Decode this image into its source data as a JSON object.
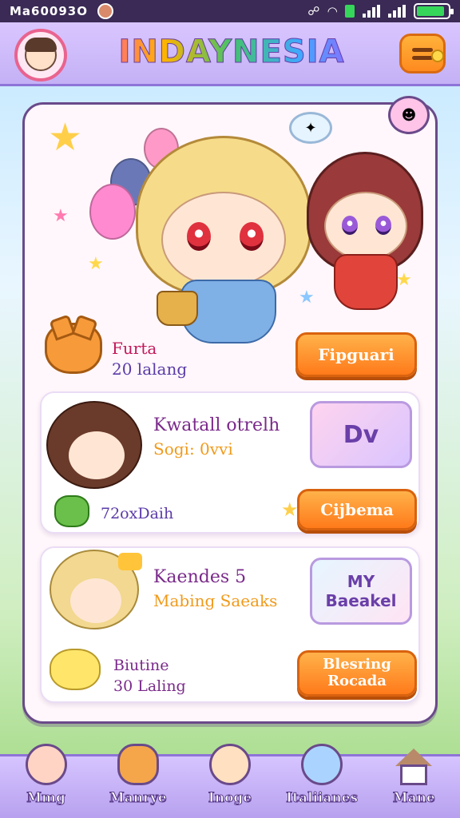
{
  "status_bar": {
    "time": "Ma60093O",
    "battery_percent": 90
  },
  "header": {
    "app_title": "INDAYNESIA"
  },
  "hero": {
    "pet_name": "Furta",
    "pet_sub": "20 lalang",
    "cta_label": "Fipguari"
  },
  "cards": [
    {
      "title": "Kwatall otrelh",
      "subtitle": "Sogi: 0vvi",
      "footer": "72oxDaih",
      "thumb_text": "Dv",
      "cta_label": "Cijbema"
    },
    {
      "title": "Kaendes 5",
      "subtitle": "Mabing Saeaks",
      "footer_line1": "Biutine",
      "footer_line2": "30 Laling",
      "thumb_text": "MY Baeakel",
      "cta_label": "Blesring Rocada"
    }
  ],
  "bottom_nav": [
    {
      "label": "Mmg",
      "icon": "girl-avatar-icon",
      "color": "#ffd4c4"
    },
    {
      "label": "Manrye",
      "icon": "bear-icon",
      "color": "#f5a64a"
    },
    {
      "label": "Inoge",
      "icon": "boy-avatar-icon",
      "color": "#ffe0c0"
    },
    {
      "label": "Italiianes",
      "icon": "ghost-icon",
      "color": "#aad4ff"
    },
    {
      "label": "Mane",
      "icon": "home-icon",
      "color": "#ffffff"
    }
  ],
  "colors": {
    "accent_orange": "#ff8a1f",
    "header_purple": "#c4b1f5",
    "panel_border": "#6a4a8a"
  }
}
